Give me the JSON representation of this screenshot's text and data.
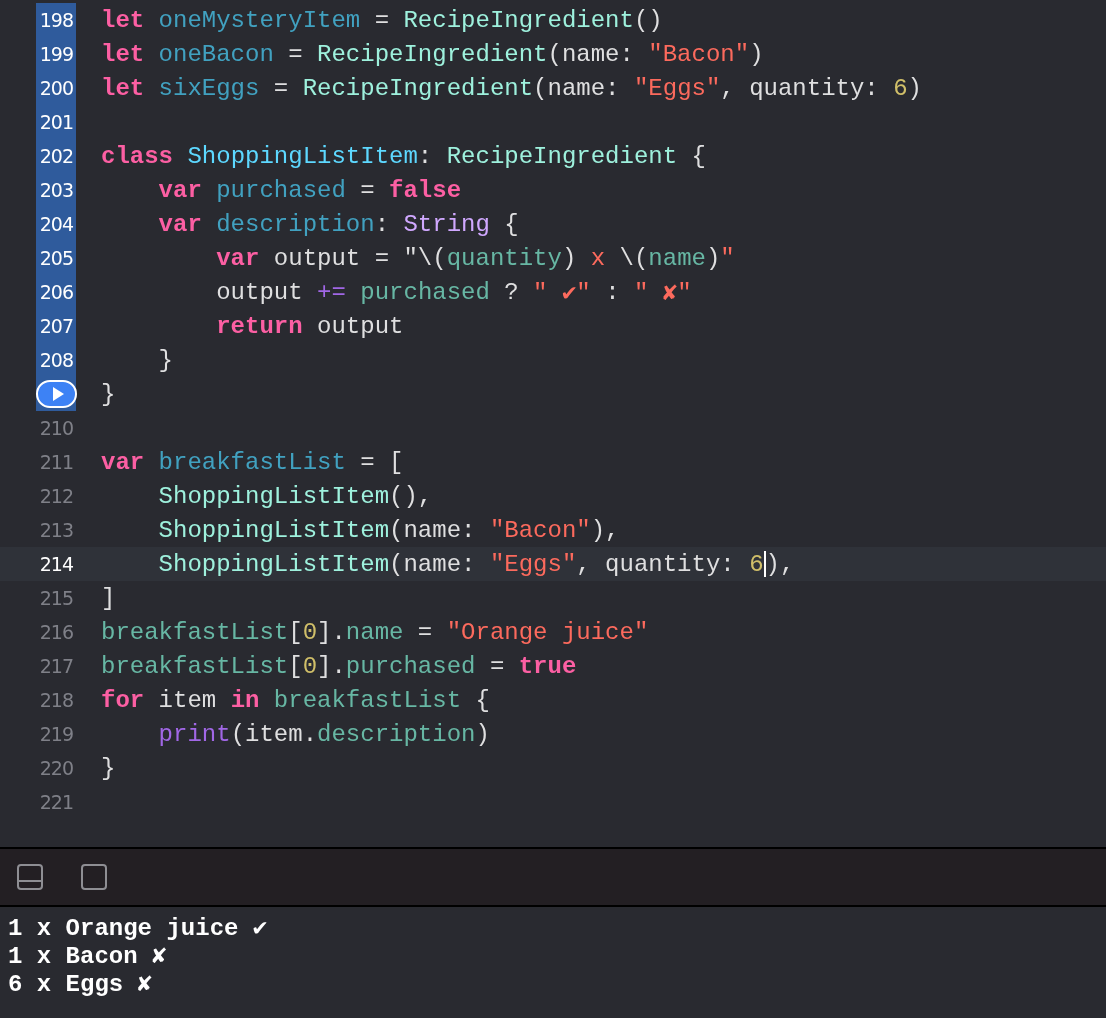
{
  "editor": {
    "lines": [
      {
        "number": "198",
        "executed": true,
        "current": false,
        "run_marker": false,
        "tokens": [
          {
            "text": "let ",
            "kind": "keyword"
          },
          {
            "text": "oneMysteryItem",
            "kind": "declaration"
          },
          {
            "text": " = ",
            "kind": "plain"
          },
          {
            "text": "RecipeIngredient",
            "kind": "type"
          },
          {
            "text": "()",
            "kind": "plain"
          }
        ]
      },
      {
        "number": "199",
        "executed": true,
        "current": false,
        "run_marker": false,
        "tokens": [
          {
            "text": "let ",
            "kind": "keyword"
          },
          {
            "text": "oneBacon",
            "kind": "declaration"
          },
          {
            "text": " = ",
            "kind": "plain"
          },
          {
            "text": "RecipeIngredient",
            "kind": "type"
          },
          {
            "text": "(name: ",
            "kind": "plain"
          },
          {
            "text": "\"Bacon\"",
            "kind": "string"
          },
          {
            "text": ")",
            "kind": "plain"
          }
        ]
      },
      {
        "number": "200",
        "executed": true,
        "current": false,
        "run_marker": false,
        "tokens": [
          {
            "text": "let ",
            "kind": "keyword"
          },
          {
            "text": "sixEggs",
            "kind": "declaration"
          },
          {
            "text": " = ",
            "kind": "plain"
          },
          {
            "text": "RecipeIngredient",
            "kind": "type"
          },
          {
            "text": "(name: ",
            "kind": "plain"
          },
          {
            "text": "\"Eggs\"",
            "kind": "string"
          },
          {
            "text": ", quantity: ",
            "kind": "plain"
          },
          {
            "text": "6",
            "kind": "number"
          },
          {
            "text": ")",
            "kind": "plain"
          }
        ]
      },
      {
        "number": "201",
        "executed": true,
        "current": false,
        "run_marker": false
      },
      {
        "number": "202",
        "executed": true,
        "current": false,
        "run_marker": false,
        "tokens": [
          {
            "text": "class ",
            "kind": "keyword"
          },
          {
            "text": "ShoppingListItem",
            "kind": "classname"
          },
          {
            "text": ": ",
            "kind": "plain"
          },
          {
            "text": "RecipeIngredient",
            "kind": "type"
          },
          {
            "text": " {",
            "kind": "plain"
          }
        ]
      },
      {
        "number": "203",
        "executed": true,
        "current": false,
        "run_marker": false,
        "tokens": [
          {
            "text": "    var ",
            "kind": "keyword"
          },
          {
            "text": "purchased",
            "kind": "declaration"
          },
          {
            "text": " = ",
            "kind": "plain"
          },
          {
            "text": "false",
            "kind": "keyword"
          }
        ]
      },
      {
        "number": "204",
        "executed": true,
        "current": false,
        "run_marker": false,
        "tokens": [
          {
            "text": "    var ",
            "kind": "keyword"
          },
          {
            "text": "description",
            "kind": "declaration"
          },
          {
            "text": ": ",
            "kind": "plain"
          },
          {
            "text": "String",
            "kind": "systemtype"
          },
          {
            "text": " {",
            "kind": "plain"
          }
        ]
      },
      {
        "number": "205",
        "executed": true,
        "current": false,
        "run_marker": false,
        "tokens": [
          {
            "text": "        var",
            "kind": "keyword"
          },
          {
            "text": " output = \"\\(",
            "kind": "plain"
          },
          {
            "text": "quantity",
            "kind": "reference"
          },
          {
            "text": ")",
            "kind": "plain"
          },
          {
            "text": " x ",
            "kind": "string"
          },
          {
            "text": "\\(",
            "kind": "plain"
          },
          {
            "text": "name",
            "kind": "reference"
          },
          {
            "text": ")",
            "kind": "plain"
          },
          {
            "text": "\"",
            "kind": "string"
          }
        ]
      },
      {
        "number": "206",
        "executed": true,
        "current": false,
        "run_marker": false,
        "tokens": [
          {
            "text": "        output ",
            "kind": "plain"
          },
          {
            "text": "+= ",
            "kind": "function"
          },
          {
            "text": "purchased",
            "kind": "reference"
          },
          {
            "text": " ? ",
            "kind": "plain"
          },
          {
            "text": "\" ✔\"",
            "kind": "string"
          },
          {
            "text": " : ",
            "kind": "plain"
          },
          {
            "text": "\" ✘\"",
            "kind": "string"
          }
        ]
      },
      {
        "number": "207",
        "executed": true,
        "current": false,
        "run_marker": false,
        "tokens": [
          {
            "text": "        return",
            "kind": "keyword"
          },
          {
            "text": " output",
            "kind": "plain"
          }
        ]
      },
      {
        "number": "208",
        "executed": true,
        "current": false,
        "run_marker": false,
        "tokens": [
          {
            "text": "    }",
            "kind": "plain"
          }
        ]
      },
      {
        "executed": true,
        "current": false,
        "run_marker": true,
        "tokens": [
          {
            "text": "}",
            "kind": "plain"
          }
        ]
      },
      {
        "number": "210",
        "executed": false,
        "current": false,
        "run_marker": false
      },
      {
        "number": "211",
        "executed": false,
        "current": false,
        "run_marker": false,
        "tokens": [
          {
            "text": "var ",
            "kind": "keyword"
          },
          {
            "text": "breakfastList",
            "kind": "declaration"
          },
          {
            "text": " = [",
            "kind": "plain"
          }
        ]
      },
      {
        "number": "212",
        "executed": false,
        "current": false,
        "run_marker": false,
        "tokens": [
          {
            "text": "    ShoppingListItem",
            "kind": "type"
          },
          {
            "text": "(),",
            "kind": "plain"
          }
        ]
      },
      {
        "number": "213",
        "executed": false,
        "current": false,
        "run_marker": false,
        "tokens": [
          {
            "text": "    ShoppingListItem",
            "kind": "type"
          },
          {
            "text": "(name: ",
            "kind": "plain"
          },
          {
            "text": "\"Bacon\"",
            "kind": "string"
          },
          {
            "text": "),",
            "kind": "plain"
          }
        ]
      },
      {
        "number": "214",
        "executed": false,
        "current": true,
        "run_marker": false,
        "tokens": [
          {
            "text": "    ShoppingListItem",
            "kind": "type"
          },
          {
            "text": "(name: ",
            "kind": "plain"
          },
          {
            "text": "\"Eggs\"",
            "kind": "string"
          },
          {
            "text": ", quantity: ",
            "kind": "plain"
          },
          {
            "text": "6",
            "kind": "number",
            "caret": true
          },
          {
            "text": "),",
            "kind": "plain"
          }
        ]
      },
      {
        "number": "215",
        "executed": false,
        "current": false,
        "run_marker": false,
        "tokens": [
          {
            "text": "]",
            "kind": "plain"
          }
        ]
      },
      {
        "number": "216",
        "executed": false,
        "current": false,
        "run_marker": false,
        "tokens": [
          {
            "text": "breakfastList",
            "kind": "reference"
          },
          {
            "text": "[",
            "kind": "plain"
          },
          {
            "text": "0",
            "kind": "number"
          },
          {
            "text": "].",
            "kind": "plain"
          },
          {
            "text": "name",
            "kind": "reference"
          },
          {
            "text": " = ",
            "kind": "plain"
          },
          {
            "text": "\"Orange juice\"",
            "kind": "string"
          }
        ]
      },
      {
        "number": "217",
        "executed": false,
        "current": false,
        "run_marker": false,
        "tokens": [
          {
            "text": "breakfastList",
            "kind": "reference"
          },
          {
            "text": "[",
            "kind": "plain"
          },
          {
            "text": "0",
            "kind": "number"
          },
          {
            "text": "].",
            "kind": "plain"
          },
          {
            "text": "purchased",
            "kind": "reference"
          },
          {
            "text": " = ",
            "kind": "plain"
          },
          {
            "text": "true",
            "kind": "keyword"
          }
        ]
      },
      {
        "number": "218",
        "executed": false,
        "current": false,
        "run_marker": false,
        "tokens": [
          {
            "text": "for",
            "kind": "keyword"
          },
          {
            "text": " item ",
            "kind": "plain"
          },
          {
            "text": "in",
            "kind": "keyword"
          },
          {
            "text": " breakfastList",
            "kind": "reference"
          },
          {
            "text": " {",
            "kind": "plain"
          }
        ]
      },
      {
        "number": "219",
        "executed": false,
        "current": false,
        "run_marker": false,
        "tokens": [
          {
            "text": "    print",
            "kind": "function"
          },
          {
            "text": "(item.",
            "kind": "plain"
          },
          {
            "text": "description",
            "kind": "reference"
          },
          {
            "text": ")",
            "kind": "plain"
          }
        ]
      },
      {
        "number": "220",
        "executed": false,
        "current": false,
        "run_marker": false,
        "tokens": [
          {
            "text": "}",
            "kind": "plain"
          }
        ]
      },
      {
        "number": "221",
        "executed": false,
        "current": false,
        "run_marker": false
      }
    ]
  },
  "console": {
    "output": [
      "1 x Orange juice ✔",
      "1 x Bacon ✘",
      "6 x Eggs ✘"
    ]
  }
}
